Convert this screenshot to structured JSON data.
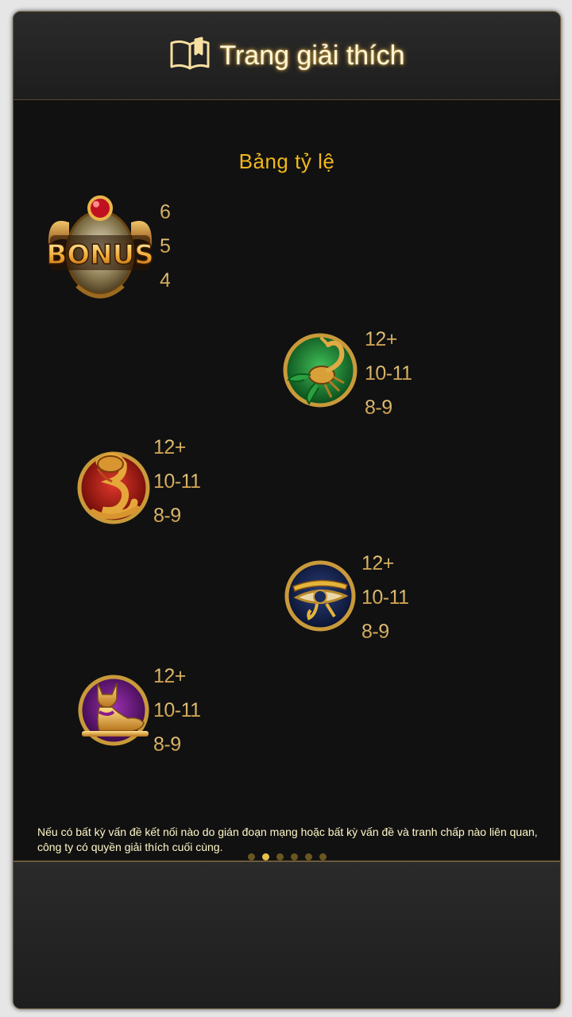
{
  "header": {
    "title": "Trang giải thích",
    "icon": "book-icon"
  },
  "paytable": {
    "title": "Bảng tỷ lệ",
    "symbols": [
      {
        "name": "bonus-scarab",
        "icon": "bonus-scarab-icon",
        "badge": "BONUS",
        "pays": [
          "6",
          "5",
          "4"
        ]
      },
      {
        "name": "scorpion",
        "icon": "scorpion-icon",
        "pays": [
          "12+",
          "10-11",
          "8-9"
        ]
      },
      {
        "name": "cobra",
        "icon": "cobra-icon",
        "pays": [
          "12+",
          "10-11",
          "8-9"
        ]
      },
      {
        "name": "eye-of-horus",
        "icon": "eye-of-horus-icon",
        "pays": [
          "12+",
          "10-11",
          "8-9"
        ]
      },
      {
        "name": "cat",
        "icon": "bastet-cat-icon",
        "pays": [
          "12+",
          "10-11",
          "8-9"
        ]
      }
    ]
  },
  "footnote": "Nếu có bất kỳ vấn đề kết nối nào do gián đoạn mạng hoặc bất kỳ vấn đề và tranh chấp nào liên quan, công ty có quyền giải thích cuối cùng.",
  "pagination": {
    "total": 6,
    "active": 2
  },
  "colors": {
    "accent": "#f0b81c",
    "pay_text": "#e9c36a",
    "background": "#111111"
  }
}
